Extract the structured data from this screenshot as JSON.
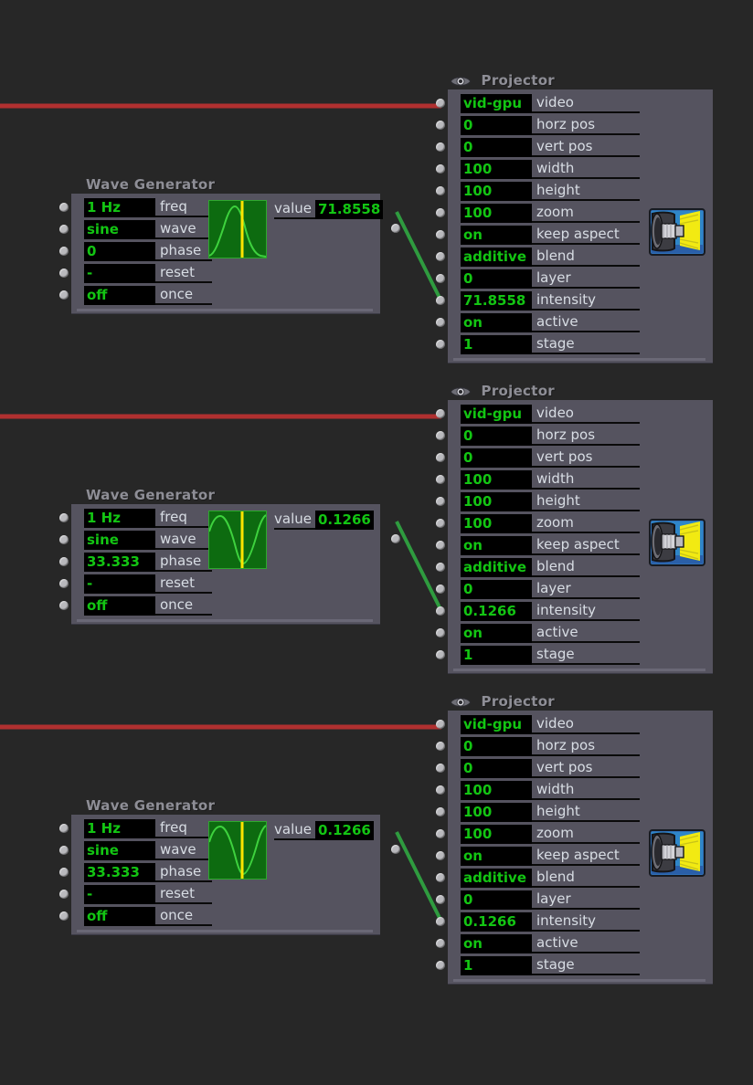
{
  "canvas": {
    "background": "#272727",
    "node_body_color": "#55535f",
    "value_text_color": "#13c513",
    "label_text_color": "#d8dde4",
    "title_text_color": "#8e8e96",
    "video_wire_color": "#b03030",
    "intensity_wire_color": "#2f9b3f"
  },
  "projectors": [
    {
      "title": "Projector",
      "icon": "eye-icon",
      "device_icon": "projector-icon",
      "params": [
        {
          "value": "vid-gpu",
          "label": "video"
        },
        {
          "value": "0",
          "label": "horz pos"
        },
        {
          "value": "0",
          "label": "vert pos"
        },
        {
          "value": "100",
          "label": "width"
        },
        {
          "value": "100",
          "label": "height"
        },
        {
          "value": "100",
          "label": "zoom"
        },
        {
          "value": "on",
          "label": "keep aspect"
        },
        {
          "value": "additive",
          "label": "blend"
        },
        {
          "value": "0",
          "label": "layer"
        },
        {
          "value": "71.8558",
          "label": "intensity"
        },
        {
          "value": "on",
          "label": "active"
        },
        {
          "value": "1",
          "label": "stage"
        }
      ]
    },
    {
      "title": "Projector",
      "icon": "eye-icon",
      "device_icon": "projector-icon",
      "params": [
        {
          "value": "vid-gpu",
          "label": "video"
        },
        {
          "value": "0",
          "label": "horz pos"
        },
        {
          "value": "0",
          "label": "vert pos"
        },
        {
          "value": "100",
          "label": "width"
        },
        {
          "value": "100",
          "label": "height"
        },
        {
          "value": "100",
          "label": "zoom"
        },
        {
          "value": "on",
          "label": "keep aspect"
        },
        {
          "value": "additive",
          "label": "blend"
        },
        {
          "value": "0",
          "label": "layer"
        },
        {
          "value": "0.1266",
          "label": "intensity"
        },
        {
          "value": "on",
          "label": "active"
        },
        {
          "value": "1",
          "label": "stage"
        }
      ]
    },
    {
      "title": "Projector",
      "icon": "eye-icon",
      "device_icon": "projector-icon",
      "params": [
        {
          "value": "vid-gpu",
          "label": "video"
        },
        {
          "value": "0",
          "label": "horz pos"
        },
        {
          "value": "0",
          "label": "vert pos"
        },
        {
          "value": "100",
          "label": "width"
        },
        {
          "value": "100",
          "label": "height"
        },
        {
          "value": "100",
          "label": "zoom"
        },
        {
          "value": "on",
          "label": "keep aspect"
        },
        {
          "value": "additive",
          "label": "blend"
        },
        {
          "value": "0",
          "label": "layer"
        },
        {
          "value": "0.1266",
          "label": "intensity"
        },
        {
          "value": "on",
          "label": "active"
        },
        {
          "value": "1",
          "label": "stage"
        }
      ]
    }
  ],
  "wave_generators": [
    {
      "title": "Wave Generator",
      "params": [
        {
          "value": "1 Hz",
          "label": "freq"
        },
        {
          "value": "sine",
          "label": "wave"
        },
        {
          "value": "0",
          "label": "phase"
        },
        {
          "value": "-",
          "label": "reset"
        },
        {
          "value": "off",
          "label": "once"
        }
      ],
      "output": {
        "label": "value",
        "value": "71.8558"
      },
      "waveform": {
        "type": "sine",
        "phase": 0,
        "playhead": 0.52,
        "curve_color": "#3ed23e",
        "background": "#0d6b10",
        "playhead_color": "#ffe400"
      }
    },
    {
      "title": "Wave Generator",
      "params": [
        {
          "value": "1 Hz",
          "label": "freq"
        },
        {
          "value": "sine",
          "label": "wave"
        },
        {
          "value": "33.333",
          "label": "phase"
        },
        {
          "value": "-",
          "label": "reset"
        },
        {
          "value": "off",
          "label": "once"
        }
      ],
      "output": {
        "label": "value",
        "value": "0.1266"
      },
      "waveform": {
        "type": "sine",
        "phase": 33.333,
        "playhead": 0.52,
        "curve_color": "#3ed23e",
        "background": "#0d6b10",
        "playhead_color": "#ffe400"
      }
    },
    {
      "title": "Wave Generator",
      "params": [
        {
          "value": "1 Hz",
          "label": "freq"
        },
        {
          "value": "sine",
          "label": "wave"
        },
        {
          "value": "33.333",
          "label": "phase"
        },
        {
          "value": "-",
          "label": "reset"
        },
        {
          "value": "off",
          "label": "once"
        }
      ],
      "output": {
        "label": "value",
        "value": "0.1266"
      },
      "waveform": {
        "type": "sine",
        "phase": 33.333,
        "playhead": 0.52,
        "curve_color": "#3ed23e",
        "background": "#0d6b10",
        "playhead_color": "#ffe400"
      }
    }
  ]
}
